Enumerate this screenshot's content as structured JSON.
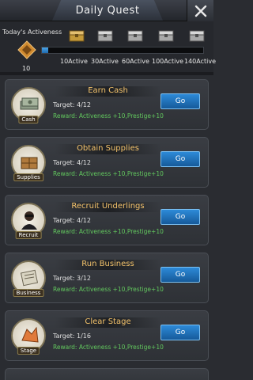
{
  "header": {
    "title": "Daily Quest"
  },
  "activeness": {
    "label": "Today's Activeness",
    "value": "10",
    "progress_fraction": 0.04,
    "milestones": [
      "10Active",
      "30Active",
      "60Active",
      "100Active",
      "140Active"
    ]
  },
  "quests": [
    {
      "title": "Earn Cash",
      "icon_caption": "Cash",
      "target": "Target: 4/12",
      "reward": "Reward: Activeness +10,Prestige+10",
      "button": "Go"
    },
    {
      "title": "Obtain Supplies",
      "icon_caption": "Supplies",
      "target": "Target: 4/12",
      "reward": "Reward: Activeness +10,Prestige+10",
      "button": "Go"
    },
    {
      "title": "Recruit Underlings",
      "icon_caption": "Recruit",
      "target": "Target: 4/12",
      "reward": "Reward: Activeness +10,Prestige+10",
      "button": "Go"
    },
    {
      "title": "Run Business",
      "icon_caption": "Business",
      "target": "Target: 3/12",
      "reward": "Reward: Activeness +10,Prestige+10",
      "button": "Go"
    },
    {
      "title": "Clear Stage",
      "icon_caption": "Stage",
      "target": "Target: 1/16",
      "reward": "Reward: Activeness +10,Prestige+10",
      "button": "Go"
    }
  ],
  "colors": {
    "accent": "#2d8ad8",
    "title": "#f3c26a",
    "reward": "#62c85e"
  }
}
